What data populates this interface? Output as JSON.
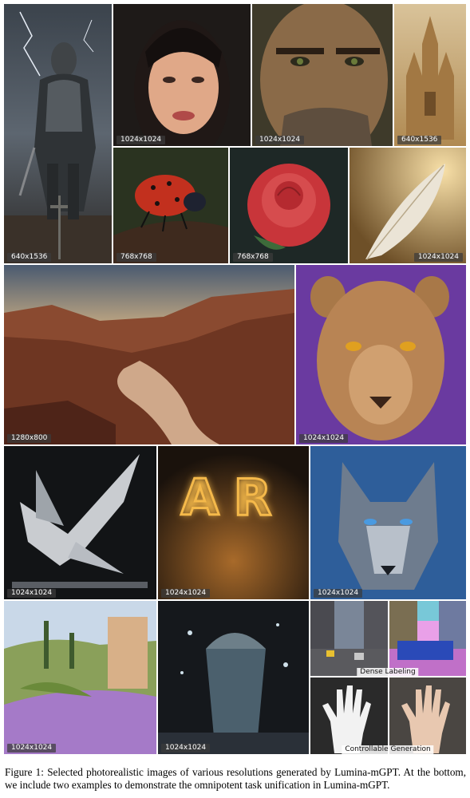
{
  "figure": {
    "tiles": [
      {
        "id": "knight",
        "label": "640x1536"
      },
      {
        "id": "woman",
        "label": "1024x1024"
      },
      {
        "id": "man",
        "label": "1024x1024"
      },
      {
        "id": "castle",
        "label": "640x1536"
      },
      {
        "id": "ladybug",
        "label": "768x768"
      },
      {
        "id": "rose",
        "label": "768x768"
      },
      {
        "id": "feather",
        "label": "1024x1024"
      },
      {
        "id": "canyon",
        "label": "1280x800"
      },
      {
        "id": "lioness",
        "label": "1024x1024"
      },
      {
        "id": "eagle",
        "label": "1024x1024"
      },
      {
        "id": "neon",
        "label": "1024x1024",
        "text": "AR"
      },
      {
        "id": "wolf",
        "label": "1024x1024"
      },
      {
        "id": "painting",
        "label": "1024x1024"
      },
      {
        "id": "glass",
        "label": "1024x1024"
      }
    ],
    "tasks": {
      "dense_labeling": "Dense Labeling",
      "controllable_generation": "Controllable Generation"
    },
    "caption": "Figure 1: Selected photorealistic images of various resolutions generated by Lumina-mGPT. At the bottom, we include two examples to demonstrate the omnipotent task unification in Lumina-mGPT."
  },
  "colors": {
    "neon": "#f5b94a",
    "lion_bg": "#6a3aa0",
    "wolf_bg": "#2e5e9a",
    "rose": "#c8353a"
  }
}
